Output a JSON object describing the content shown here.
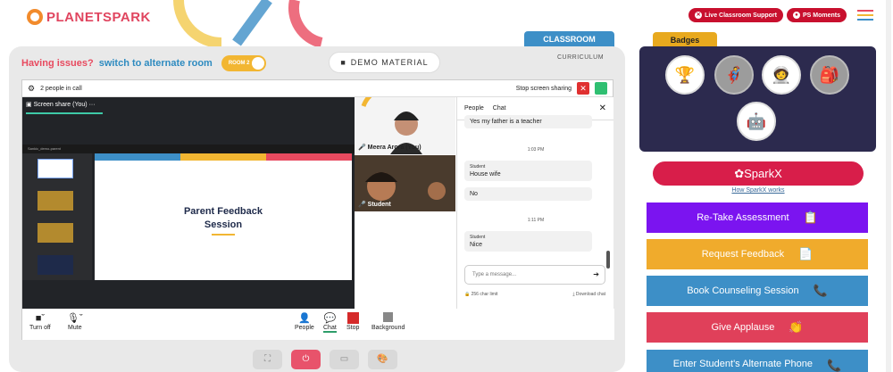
{
  "brand": {
    "logo_text": "PLANETSPARK"
  },
  "header": {
    "live_support": "Live Classroom Support",
    "ps_moments": "PS Moments"
  },
  "classroom": {
    "issue_text": "Having issues?",
    "issue_link": "switch to alternate room",
    "room_toggle": "ROOM 2",
    "demo_material": "DEMO MATERIAL",
    "curriculum": "CURRICULUM",
    "classroom_tab": "CLASSROOM"
  },
  "call": {
    "people_count": "2 people in call",
    "stop_sharing": "Stop screen sharing",
    "screen_share_label": "Screen share (You)",
    "slides_title": "Sankic_demo-parent",
    "slide_title_line1": "Parent Feedback",
    "slide_title_line2": "Session",
    "tile_teacher": "Meera Arora (You)",
    "tile_student": "Student"
  },
  "chat": {
    "tab_people": "People",
    "tab_chat": "Chat",
    "messages": [
      {
        "who": "",
        "text": "Yes my father is a teacher"
      },
      {
        "time": "1:03 PM"
      },
      {
        "who": "Student",
        "text": "House wife"
      },
      {
        "who": "",
        "text": "No"
      },
      {
        "time": "1:11 PM"
      },
      {
        "who": "Student",
        "text": "Nice"
      }
    ],
    "input_placeholder": "Type a message...",
    "char_limit": "256 char limit",
    "download": "Download chat"
  },
  "controls": {
    "turn_off": "Turn off",
    "mute": "Mute",
    "people": "People",
    "chat": "Chat",
    "stop": "Stop",
    "background": "Background"
  },
  "right": {
    "badges_tab": "Badges",
    "sparkx": "SparkX",
    "sparkx_link": "How SparkX works",
    "actions": [
      {
        "label": "Re-Take Assessment",
        "color": "#7b14f0",
        "icon": "clipboard-icon"
      },
      {
        "label": "Request Feedback",
        "color": "#f0ab2c",
        "icon": "document-icon"
      },
      {
        "label": "Book Counseling Session",
        "color": "#3d8fc7",
        "icon": "phone-icon"
      },
      {
        "label": "Give Applause",
        "color": "#e0405a",
        "icon": "clap-icon"
      },
      {
        "label": "Enter Student's Alternate Phone",
        "color": "#3d8fc7",
        "icon": "phone-icon"
      }
    ]
  },
  "colors": {
    "accent_red": "#d81e4a",
    "badge_bg": "#2c2a4e",
    "classroom_blue": "#3d8fc7"
  }
}
